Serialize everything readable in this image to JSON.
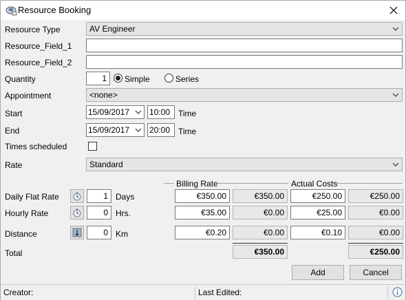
{
  "window": {
    "title": "Resource Booking"
  },
  "labels": {
    "resource_type": "Resource Type",
    "field1": "Resource_Field_1",
    "field2": "Resource_Field_2",
    "quantity": "Quantity",
    "appointment": "Appointment",
    "start": "Start",
    "end": "End",
    "times_scheduled": "Times scheduled",
    "rate": "Rate",
    "daily_flat_rate": "Daily Flat Rate",
    "hourly_rate": "Hourly Rate",
    "distance": "Distance",
    "total": "Total",
    "time": "Time",
    "simple": "Simple",
    "series": "Series",
    "billing_rate": "Billing Rate",
    "actual_costs": "Actual Costs"
  },
  "fields": {
    "resource_type": "AV Engineer",
    "field1": "",
    "field2": "",
    "quantity": "1",
    "recurrence": "Simple",
    "appointment": "<none>",
    "start_date": "15/09/2017",
    "start_time": "10:00",
    "end_date": "15/09/2017",
    "end_time": "20:00",
    "times_scheduled": false,
    "rate": "Standard"
  },
  "rows": {
    "daily": {
      "qty": "1",
      "unit": "Days",
      "billing_rate": "€350.00",
      "billing_total": "€350.00",
      "actual_rate": "€250.00",
      "actual_total": "€250.00"
    },
    "hourly": {
      "qty": "0",
      "unit": "Hrs.",
      "billing_rate": "€35.00",
      "billing_total": "€0.00",
      "actual_rate": "€25.00",
      "actual_total": "€0.00"
    },
    "distance": {
      "qty": "0",
      "unit": "Km",
      "billing_rate": "€0.20",
      "billing_total": "€0.00",
      "actual_rate": "€0.10",
      "actual_total": "€0.00"
    }
  },
  "totals": {
    "billing": "€350.00",
    "actual": "€250.00"
  },
  "buttons": {
    "add": "Add",
    "cancel": "Cancel"
  },
  "status": {
    "creator": "Creator:",
    "last_edited": "Last Edited:"
  },
  "icons": {
    "app": "resource-booking-icon",
    "close": "close-icon",
    "dropdown": "chevron-down-icon",
    "daily_calc": "stopwatch-icon",
    "hourly_calc": "stopwatch-icon",
    "distance_calc": "map-pin-icon",
    "info": "info-icon"
  }
}
